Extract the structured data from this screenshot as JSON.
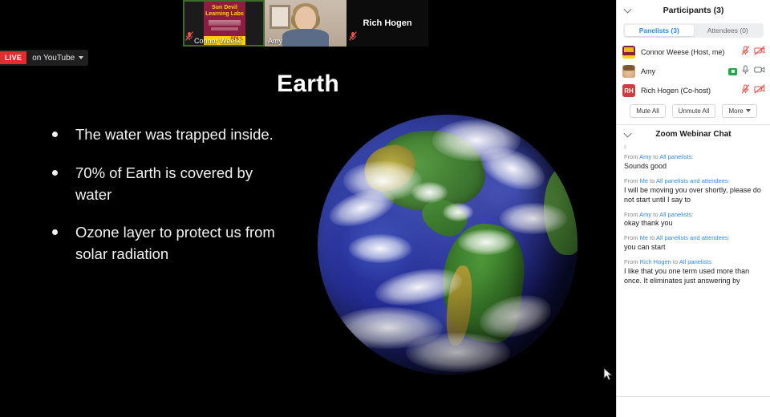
{
  "stream_badge": {
    "live_label": "LIVE",
    "platform_label": "on YouTube"
  },
  "video_strip": [
    {
      "name": "Connor Weese",
      "muted": true,
      "active_speaker": true,
      "tile_type": "avatar-card",
      "card": {
        "line1": "Sun Devil",
        "line2": "Learning Labs",
        "footer_tag": "SDLL"
      }
    },
    {
      "name": "Amy",
      "muted": false,
      "active_speaker": false,
      "tile_type": "webcam"
    },
    {
      "name": "Rich Hogen",
      "muted": true,
      "active_speaker": false,
      "tile_type": "name-only"
    }
  ],
  "slide": {
    "title": "Earth",
    "bullets": [
      "The water was trapped inside.",
      "70% of Earth is covered by water",
      "Ozone layer to protect us from solar radiation"
    ],
    "image_alt": "Earth globe showing the Americas"
  },
  "participants_panel": {
    "title": "Participants (3)",
    "tabs": [
      {
        "label": "Panelists (3)",
        "active": true
      },
      {
        "label": "Attendees (0)",
        "active": false
      }
    ],
    "rows": [
      {
        "name": "Connor Weese (Host, me)",
        "avatar_text": "",
        "avatar_type": "sun-devil-card",
        "mic": "muted",
        "video": "off",
        "speaking_badge": false
      },
      {
        "name": "Amy",
        "avatar_text": "",
        "avatar_type": "photo",
        "mic": "on",
        "video": "on",
        "speaking_badge": true
      },
      {
        "name": "Rich Hogen (Co-host)",
        "avatar_text": "RH",
        "avatar_type": "initials",
        "mic": "muted",
        "video": "off",
        "speaking_badge": false
      }
    ],
    "buttons": [
      {
        "label": "Mute All"
      },
      {
        "label": "Unmute All"
      },
      {
        "label": "More",
        "has_caret": true
      }
    ]
  },
  "chat_panel": {
    "title": "Zoom Webinar Chat",
    "messages": [
      {
        "from_prefix": "From ",
        "sender": "Amy",
        "to_mid": " to ",
        "recipient": "All panelists",
        "colon": ":",
        "text": "Sounds good"
      },
      {
        "from_prefix": "From ",
        "sender": "Me",
        "to_mid": " to ",
        "recipient": "All panelists and attendees",
        "colon": ":",
        "text": "I will be moving you over shortly, please do not start until I say to"
      },
      {
        "from_prefix": "From ",
        "sender": "Amy",
        "to_mid": " to ",
        "recipient": "All panelists",
        "colon": ":",
        "text": "okay thank you"
      },
      {
        "from_prefix": "From ",
        "sender": "Me",
        "to_mid": " to ",
        "recipient": "All panelists and attendees",
        "colon": ":",
        "text": "you can start"
      },
      {
        "from_prefix": "From ",
        "sender": "Rich Hogen",
        "to_mid": " to ",
        "recipient": "All panelists",
        "colon": ":",
        "text": "I like that you one term used more than once. It eliminates just answering by"
      }
    ]
  },
  "colors": {
    "accent_blue": "#2d8cff",
    "live_red": "#e02d2d",
    "muted_red": "#e8554e",
    "speaking_green": "#23a94a",
    "asu_maroon": "#8c1d40",
    "asu_gold": "#ffd200"
  }
}
